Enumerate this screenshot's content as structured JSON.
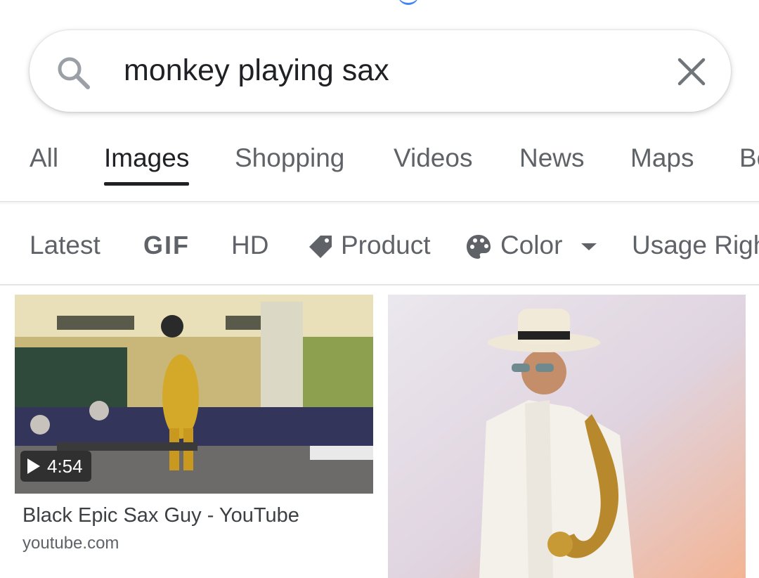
{
  "search": {
    "query": "monkey playing sax",
    "clear_icon": "close-icon",
    "search_icon": "search-icon"
  },
  "tabs": [
    {
      "label": "All",
      "active": false
    },
    {
      "label": "Images",
      "active": true
    },
    {
      "label": "Shopping",
      "active": false
    },
    {
      "label": "Videos",
      "active": false
    },
    {
      "label": "News",
      "active": false
    },
    {
      "label": "Maps",
      "active": false
    },
    {
      "label": "Books",
      "active": false
    }
  ],
  "chips": {
    "latest": "Latest",
    "gif": "GIF",
    "hd": "HD",
    "product": "Product",
    "color": "Color",
    "usage_rights": "Usage Rights"
  },
  "results": [
    {
      "title": "Black Epic Sax Guy - YouTube",
      "source": "youtube.com",
      "duration": "4:54"
    },
    {
      "title": "",
      "source": ""
    }
  ],
  "colors": {
    "accent": "#4285f4",
    "text": "#202124",
    "muted": "#5f6368"
  }
}
